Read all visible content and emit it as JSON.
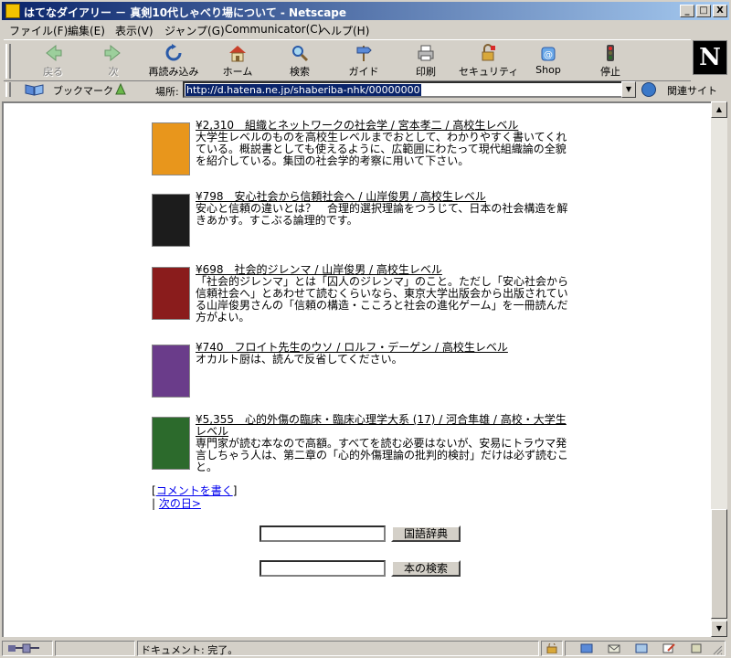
{
  "window": {
    "title": "はてなダイアリー － 真剣10代しゃべり場について - Netscape",
    "minimize": "_",
    "maximize": "□",
    "close": "X"
  },
  "menu": [
    "ファイル(F)",
    "編集(E)",
    "表示(V)",
    "ジャンプ(G)",
    "Communicator(C)",
    "ヘルプ(H)"
  ],
  "toolbar": {
    "buttons": [
      "戻る",
      "次",
      "再読み込み",
      "ホーム",
      "検索",
      "ガイド",
      "印刷",
      "セキュリティ",
      "Shop",
      "停止"
    ],
    "logo": "N"
  },
  "location": {
    "bookmarks_label": "ブックマーク",
    "label": "場所:",
    "url": "http://d.hatena.ne.jp/shaberiba-nhk/00000000",
    "related_label": "関連サイト"
  },
  "books": [
    {
      "title": "¥2,310　組織とネットワークの社会学 / 宮本孝二 / 高校生レベル",
      "desc": "大学生レベルのものを高校生レベルまでおとして、わかりやすく書いてくれている。概説書としても使えるように、広範囲にわたって現代組織論の全貌を紹介している。集団の社会学的考察に用いて下さい。",
      "cover_color": "#e8961c"
    },
    {
      "title": "¥798　安心社会から信頼社会へ / 山岸俊男 / 高校生レベル",
      "desc": "安心と信頼の違いとは？　合理的選択理論をつうじて、日本の社会構造を解きあかす。すこぶる論理的です。",
      "cover_color": "#1c1c1c"
    },
    {
      "title": "¥698　社会的ジレンマ / 山岸俊男 / 高校生レベル",
      "desc": "「社会的ジレンマ」とは「囚人のジレンマ」のこと。ただし「安心社会から信頼社会へ」とあわせて読むくらいなら、東京大学出版会から出版されている山岸俊男さんの「信頼の構造・こころと社会の進化ゲーム」を一冊読んだ方がよい。",
      "cover_color": "#8a1c1c"
    },
    {
      "title": "¥740　フロイト先生のウソ / ロルフ・デーゲン / 高校生レベル",
      "desc": "オカルト厨は、読んで反省してください。",
      "cover_color": "#6a3c8a"
    },
    {
      "title": "¥5,355　心的外傷の臨床・臨床心理学大系 (17) / 河合隼雄 / 高校・大学生レベル",
      "desc": "専門家が読む本なので高額。すべてを読む必要はないが、安易にトラウマ発言しちゃう人は、第二章の「心的外傷理論の批判的検討」だけは必ず読むこと。",
      "cover_color": "#2c6a2c"
    }
  ],
  "comment_link": "コメントを書く",
  "next_link": "次の日>",
  "forms": {
    "dictionary_button": "国語辞典",
    "book_search_button": "本の検索"
  },
  "status": {
    "text": "ドキュメント: 完了。"
  }
}
